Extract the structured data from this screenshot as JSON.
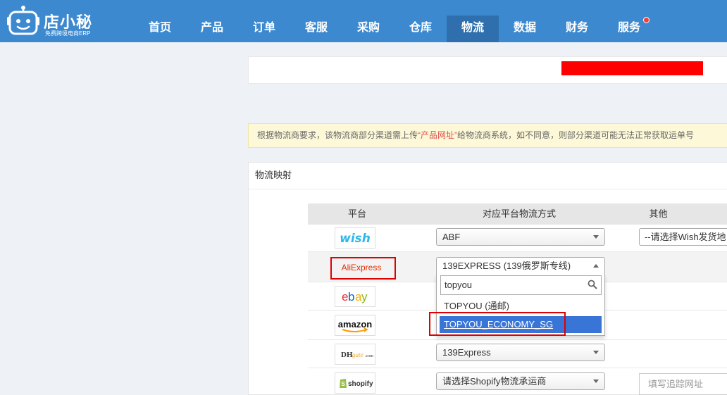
{
  "app": {
    "logo_title": "店小秘",
    "logo_subtitle": "免费跨境电商ERP"
  },
  "nav": {
    "items": [
      {
        "label": "首页"
      },
      {
        "label": "产品"
      },
      {
        "label": "订单"
      },
      {
        "label": "客服"
      },
      {
        "label": "采购"
      },
      {
        "label": "仓库"
      },
      {
        "label": "物流"
      },
      {
        "label": "数据"
      },
      {
        "label": "财务"
      },
      {
        "label": "服务"
      }
    ],
    "active_index": 6,
    "notification_dot_on": "服务"
  },
  "notice": {
    "text_before": "根据物流商要求，该物流商部分渠道需上传",
    "highlight": "“产品网址”",
    "text_after": "给物流商系统，如不同意，则部分渠道可能无法正常获取运单号"
  },
  "panel": {
    "title": "物流映射",
    "columns": [
      "平台",
      "对应平台物流方式",
      "其他"
    ]
  },
  "rows": [
    {
      "platform": "wish",
      "logo_icon": "wish-logo",
      "method": "ABF",
      "other": "--请选择Wish发货地"
    },
    {
      "platform": "AliExpress",
      "logo_icon": "aliexpress-logo",
      "method": "139EXPRESS (139俄罗斯专线)",
      "other": ""
    },
    {
      "platform": "ebay",
      "logo_icon": "ebay-logo",
      "method": "",
      "other": ""
    },
    {
      "platform": "amazon",
      "logo_icon": "amazon-logo",
      "method": "",
      "other": ""
    },
    {
      "platform": "DHgate.com",
      "logo_icon": "dhgate-logo",
      "method": "139Express",
      "other": ""
    },
    {
      "platform": "shopify",
      "logo_icon": "shopify-logo",
      "method": "请选择Shopify物流承运商",
      "other_placeholder": "填写追踪网址"
    }
  ],
  "dropdown": {
    "search_value": "topyou",
    "options": [
      {
        "label": "TOPYOU (通邮)",
        "highlighted": false
      },
      {
        "label": "TOPYOU_ECONOMY_SG",
        "highlighted": true
      }
    ]
  },
  "colors": {
    "nav_bg": "#3d89d0",
    "nav_active": "#2f6fad",
    "highlight_option": "#3875d7",
    "annotation_red": "#e00000",
    "redacted_bar": "#ff0000"
  }
}
